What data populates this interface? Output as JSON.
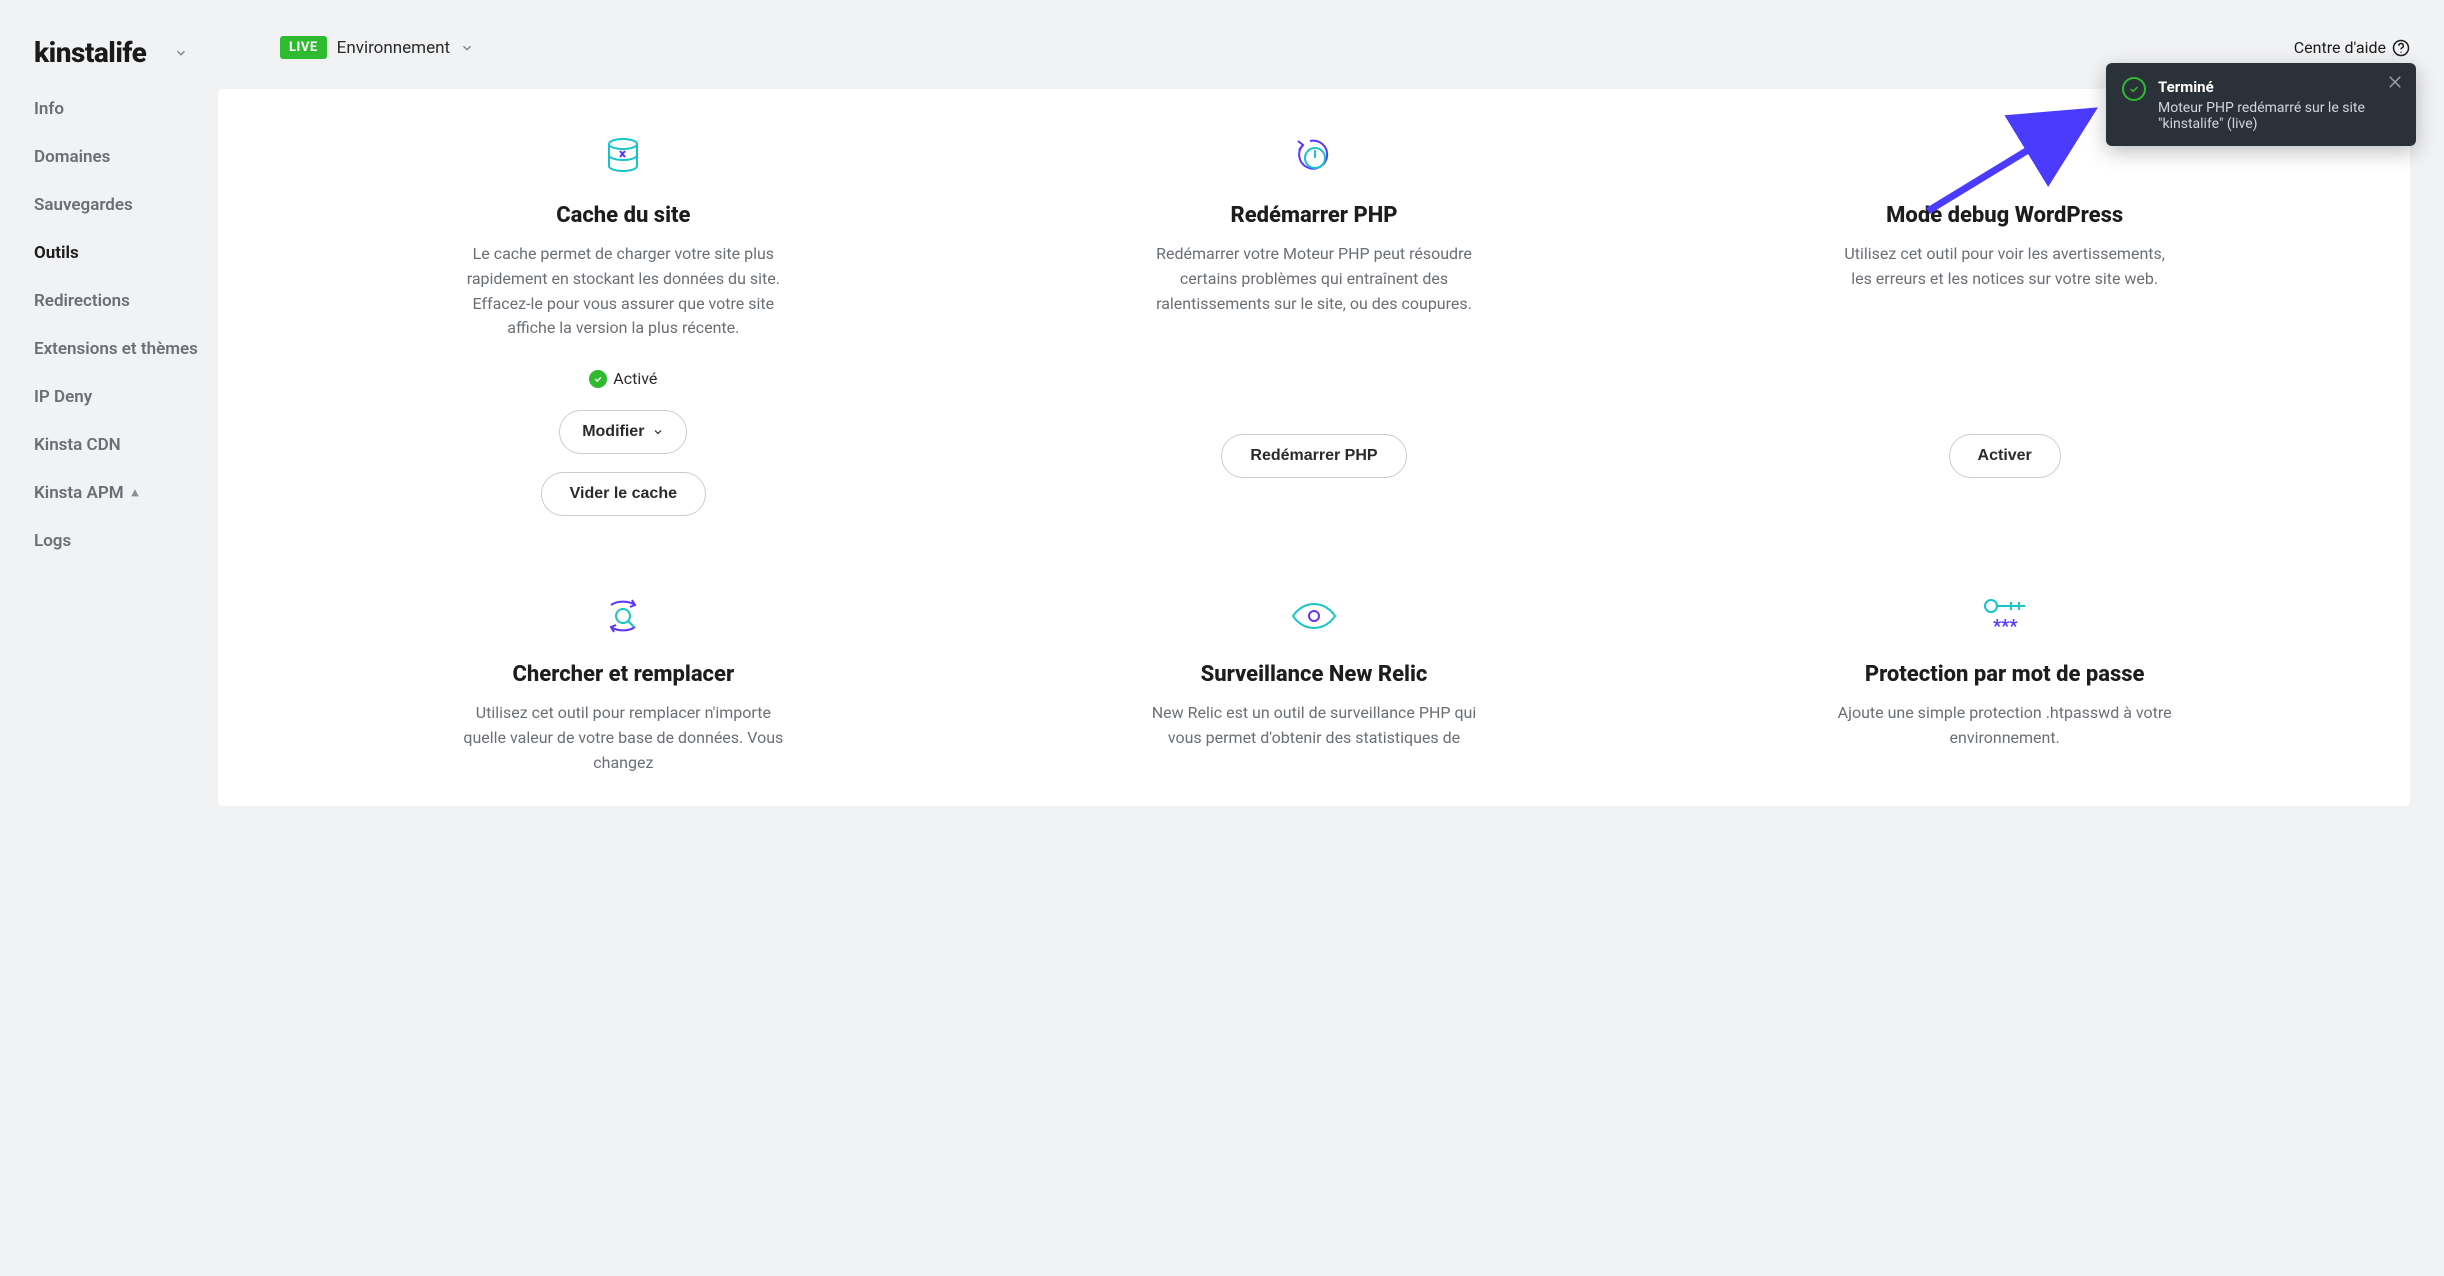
{
  "brand": "kinstalife",
  "env": {
    "badge": "LIVE",
    "label": "Environnement"
  },
  "help_label": "Centre d'aide",
  "sidebar": {
    "items": [
      {
        "label": "Info"
      },
      {
        "label": "Domaines"
      },
      {
        "label": "Sauvegardes"
      },
      {
        "label": "Outils",
        "active": true
      },
      {
        "label": "Redirections"
      },
      {
        "label": "Extensions et thèmes"
      },
      {
        "label": "IP Deny"
      },
      {
        "label": "Kinsta CDN"
      },
      {
        "label": "Kinsta APM"
      },
      {
        "label": "Logs"
      }
    ]
  },
  "cards": [
    {
      "title": "Cache du site",
      "desc": "Le cache permet de charger votre site plus rapidement en stockant les données du site. Effacez-le pour vous assurer que votre site affiche la version la plus récente.",
      "status": "Activé",
      "btn1": "Modifier",
      "btn2": "Vider le cache"
    },
    {
      "title": "Redémarrer PHP",
      "desc": "Redémarrer votre Moteur PHP peut résoudre certains problèmes qui entraînent des ralentissements sur le site, ou des coupures.",
      "btn": "Redémarrer PHP"
    },
    {
      "title": "Mode debug WordPress",
      "desc": "Utilisez cet outil pour voir les avertissements, les erreurs et les notices sur votre site web.",
      "btn": "Activer"
    },
    {
      "title": "Chercher et remplacer",
      "desc": "Utilisez cet outil pour remplacer n'importe quelle valeur de votre base de données. Vous changez"
    },
    {
      "title": "Surveillance New Relic",
      "desc": "New Relic est un outil de surveillance PHP qui vous permet d'obtenir des statistiques de"
    },
    {
      "title": "Protection par mot de passe",
      "desc": "Ajoute une simple protection .htpasswd à votre environnement."
    }
  ],
  "toast": {
    "title": "Terminé",
    "body": "Moteur PHP redémarré sur le site \"kinstalife\" (live)"
  }
}
